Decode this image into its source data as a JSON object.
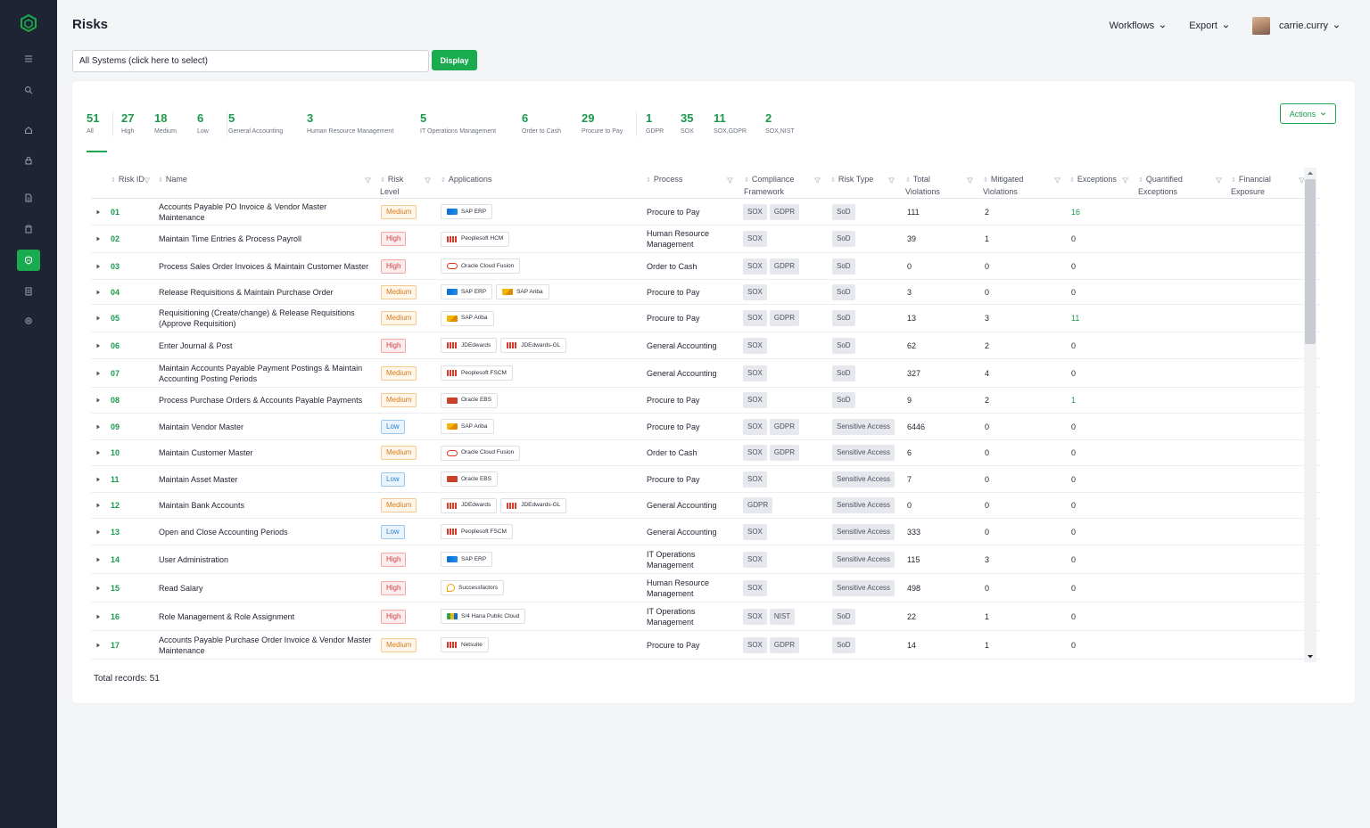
{
  "page": {
    "title": "Risks",
    "workflows_label": "Workflows",
    "export_label": "Export",
    "username": "carrie.curry"
  },
  "system_select": {
    "value": "All Systems (click here to select)",
    "display_label": "Display"
  },
  "actions_label": "Actions",
  "stats": [
    {
      "num": "51",
      "label": "All"
    },
    {
      "num": "27",
      "label": "High"
    },
    {
      "num": "18",
      "label": "Medium"
    },
    {
      "num": "6",
      "label": "Low"
    },
    {
      "num": "5",
      "label": "General Accounting"
    },
    {
      "num": "3",
      "label": "Human Resource Management"
    },
    {
      "num": "5",
      "label": "IT Operations Management"
    },
    {
      "num": "6",
      "label": "Order to Cash"
    },
    {
      "num": "29",
      "label": "Procure to Pay"
    },
    {
      "num": "1",
      "label": "GDPR"
    },
    {
      "num": "35",
      "label": "SOX"
    },
    {
      "num": "11",
      "label": "SOX,GDPR"
    },
    {
      "num": "2",
      "label": "SOX,NIST"
    }
  ],
  "columns": {
    "risk_id": "Risk ID",
    "name": "Name",
    "risk_level": "Risk Level",
    "applications": "Applications",
    "process": "Process",
    "compliance": "Compliance Framework",
    "risk_type": "Risk Type",
    "total_violations": "Total Violations",
    "mitigated_violations": "Mitigated Violations",
    "exceptions": "Exceptions",
    "quantified_exceptions": "Quantified Exceptions",
    "financial_exposure": "Financial Exposure"
  },
  "rows": [
    {
      "id": "01",
      "name": "Accounts Payable PO Invoice & Vendor Master Maintenance",
      "level": "Medium",
      "apps": [
        "SAP ERP"
      ],
      "process": "Procure to Pay",
      "compliance": [
        "SOX",
        "GDPR"
      ],
      "type": "SoD",
      "total": "111",
      "mitigated": "2",
      "exceptions": "16"
    },
    {
      "id": "02",
      "name": "Maintain Time Entries & Process Payroll",
      "level": "High",
      "apps": [
        "Peoplesoft HCM"
      ],
      "process": "Human Resource Management",
      "compliance": [
        "SOX"
      ],
      "type": "SoD",
      "total": "39",
      "mitigated": "1",
      "exceptions": "0"
    },
    {
      "id": "03",
      "name": "Process Sales Order Invoices & Maintain Customer Master",
      "level": "High",
      "apps": [
        "Oracle Cloud Fusion"
      ],
      "process": "Order to Cash",
      "compliance": [
        "SOX",
        "GDPR"
      ],
      "type": "SoD",
      "total": "0",
      "mitigated": "0",
      "exceptions": "0"
    },
    {
      "id": "04",
      "name": "Release Requisitions & Maintain Purchase Order",
      "level": "Medium",
      "apps": [
        "SAP ERP",
        "SAP Ariba"
      ],
      "process": "Procure to Pay",
      "compliance": [
        "SOX"
      ],
      "type": "SoD",
      "total": "3",
      "mitigated": "0",
      "exceptions": "0"
    },
    {
      "id": "05",
      "name": "Requisitioning (Create/change) & Release Requisitions (Approve Requisition)",
      "level": "Medium",
      "apps": [
        "SAP Ariba"
      ],
      "process": "Procure to Pay",
      "compliance": [
        "SOX",
        "GDPR"
      ],
      "type": "SoD",
      "total": "13",
      "mitigated": "3",
      "exceptions": "11"
    },
    {
      "id": "06",
      "name": "Enter Journal & Post",
      "level": "High",
      "apps": [
        "JDEdwards",
        "JDEdwards-GL"
      ],
      "process": "General Accounting",
      "compliance": [
        "SOX"
      ],
      "type": "SoD",
      "total": "62",
      "mitigated": "2",
      "exceptions": "0"
    },
    {
      "id": "07",
      "name": "Maintain Accounts Payable Payment Postings & Maintain Accounting Posting Periods",
      "level": "Medium",
      "apps": [
        "Peoplesoft FSCM"
      ],
      "process": "General Accounting",
      "compliance": [
        "SOX"
      ],
      "type": "SoD",
      "total": "327",
      "mitigated": "4",
      "exceptions": "0"
    },
    {
      "id": "08",
      "name": "Process Purchase Orders & Accounts Payable Payments",
      "level": "Medium",
      "apps": [
        "Oracle EBS"
      ],
      "process": "Procure to Pay",
      "compliance": [
        "SOX"
      ],
      "type": "SoD",
      "total": "9",
      "mitigated": "2",
      "exceptions": "1"
    },
    {
      "id": "09",
      "name": "Maintain Vendor Master",
      "level": "Low",
      "apps": [
        "SAP Ariba"
      ],
      "process": "Procure to Pay",
      "compliance": [
        "SOX",
        "GDPR"
      ],
      "type": "Sensitive Access",
      "total": "6446",
      "mitigated": "0",
      "exceptions": "0"
    },
    {
      "id": "10",
      "name": "Maintain Customer Master",
      "level": "Medium",
      "apps": [
        "Oracle Cloud Fusion"
      ],
      "process": "Order to Cash",
      "compliance": [
        "SOX",
        "GDPR"
      ],
      "type": "Sensitive Access",
      "total": "6",
      "mitigated": "0",
      "exceptions": "0"
    },
    {
      "id": "11",
      "name": "Maintain Asset Master",
      "level": "Low",
      "apps": [
        "Oracle EBS"
      ],
      "process": "Procure to Pay",
      "compliance": [
        "SOX"
      ],
      "type": "Sensitive Access",
      "total": "7",
      "mitigated": "0",
      "exceptions": "0"
    },
    {
      "id": "12",
      "name": "Maintain Bank Accounts",
      "level": "Medium",
      "apps": [
        "JDEdwards",
        "JDEdwards-GL"
      ],
      "process": "General Accounting",
      "compliance": [
        "GDPR"
      ],
      "type": "Sensitive Access",
      "total": "0",
      "mitigated": "0",
      "exceptions": "0"
    },
    {
      "id": "13",
      "name": "Open and Close Accounting Periods",
      "level": "Low",
      "apps": [
        "Peoplesoft FSCM"
      ],
      "process": "General Accounting",
      "compliance": [
        "SOX"
      ],
      "type": "Sensitive Access",
      "total": "333",
      "mitigated": "0",
      "exceptions": "0"
    },
    {
      "id": "14",
      "name": "User Administration",
      "level": "High",
      "apps": [
        "SAP ERP"
      ],
      "process": "IT Operations Management",
      "compliance": [
        "SOX"
      ],
      "type": "Sensitive Access",
      "total": "115",
      "mitigated": "3",
      "exceptions": "0"
    },
    {
      "id": "15",
      "name": "Read Salary",
      "level": "High",
      "apps": [
        "Successfactors"
      ],
      "process": "Human Resource Management",
      "compliance": [
        "SOX"
      ],
      "type": "Sensitive Access",
      "total": "498",
      "mitigated": "0",
      "exceptions": "0"
    },
    {
      "id": "16",
      "name": "Role Management & Role Assignment",
      "level": "High",
      "apps": [
        "S/4 Hana Public Cloud"
      ],
      "process": "IT Operations Management",
      "compliance": [
        "SOX",
        "NIST"
      ],
      "type": "SoD",
      "total": "22",
      "mitigated": "1",
      "exceptions": "0"
    },
    {
      "id": "17",
      "name": "Accounts Payable Purchase Order Invoice & Vendor Master Maintenance",
      "level": "Medium",
      "apps": [
        "Netsuite"
      ],
      "process": "Procure to Pay",
      "compliance": [
        "SOX",
        "GDPR"
      ],
      "type": "SoD",
      "total": "14",
      "mitigated": "1",
      "exceptions": "0"
    }
  ],
  "footer": {
    "total_records": "Total records: 51"
  },
  "colors": {
    "accent": "#1aab4f",
    "sidebar": "#1e2433"
  },
  "icons": [
    "logo-icon",
    "menu-icon",
    "search-icon",
    "home-icon",
    "lock-icon",
    "document-icon",
    "clipboard-icon",
    "shield-icon",
    "list-icon",
    "gear-icon"
  ]
}
